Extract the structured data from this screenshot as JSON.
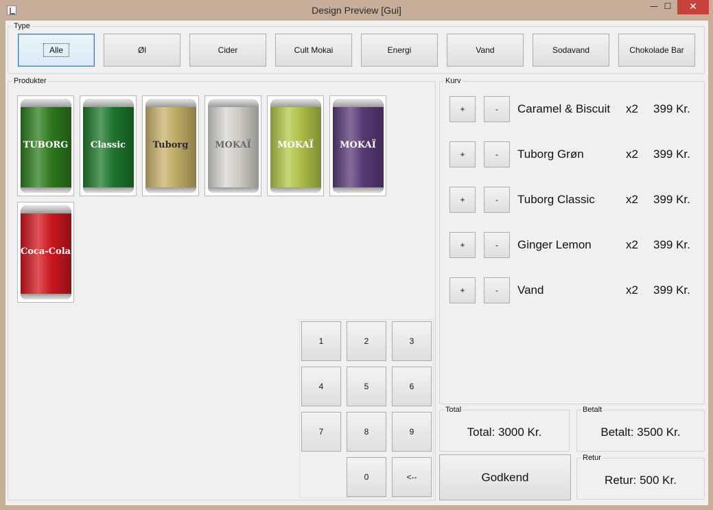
{
  "window": {
    "title": "Design Preview [Gui]",
    "minimize_glyph": "—",
    "maximize_glyph": "☐",
    "close_glyph": "✕"
  },
  "type_group": {
    "title": "Type",
    "buttons": [
      "Alle",
      "Øl",
      "Cider",
      "Cult Mokai",
      "Energi",
      "Vand",
      "Sodavand",
      "Chokolade Bar"
    ],
    "selected": "Alle"
  },
  "products_group": {
    "title": "Produkter",
    "items": [
      {
        "name": "Tuborg Grøn",
        "label": "TUBORG",
        "color": "#2f7d1f",
        "text_color": "#ffffff"
      },
      {
        "name": "Tuborg Classic",
        "label": "Classic",
        "color": "#1f7a2c",
        "text_color": "#ffffff"
      },
      {
        "name": "Tuborg Gold",
        "label": "Tuborg",
        "color": "#c9b36b",
        "text_color": "#2a2a2a"
      },
      {
        "name": "Cult Mokai",
        "label": "MOKAÏ",
        "color": "#d9d6cf",
        "text_color": "#6a6a6a"
      },
      {
        "name": "Mokai Lime",
        "label": "MOKAÏ",
        "color": "#b6c74a",
        "text_color": "#ffffff"
      },
      {
        "name": "Mokai Purple",
        "label": "MOKAÏ",
        "color": "#5b3b7a",
        "text_color": "#ffffff"
      },
      {
        "name": "Coca-Cola",
        "label": "Coca-Cola",
        "color": "#d3181f",
        "text_color": "#ffffff"
      }
    ]
  },
  "keypad": {
    "keys": [
      "1",
      "2",
      "3",
      "4",
      "5",
      "6",
      "7",
      "8",
      "9",
      "0",
      "<--"
    ]
  },
  "cart_group": {
    "title": "Kurv",
    "plus_label": "+",
    "minus_label": "-",
    "items": [
      {
        "name": "Caramel & Biscuit",
        "qty": "x2",
        "price": "399 Kr."
      },
      {
        "name": "Tuborg Grøn",
        "qty": "x2",
        "price": "399 Kr."
      },
      {
        "name": "Tuborg Classic",
        "qty": "x2",
        "price": "399 Kr."
      },
      {
        "name": "Ginger Lemon",
        "qty": "x2",
        "price": "399 Kr."
      },
      {
        "name": "Vand",
        "qty": "x2",
        "price": "399 Kr."
      }
    ]
  },
  "total_group": {
    "title": "Total",
    "value": "Total: 3000 Kr."
  },
  "paid_group": {
    "title": "Betalt",
    "value": "Betalt: 3500 Kr."
  },
  "return_group": {
    "title": "Retur",
    "value": "Retur: 500 Kr."
  },
  "approve_button": {
    "label": "Godkend"
  }
}
